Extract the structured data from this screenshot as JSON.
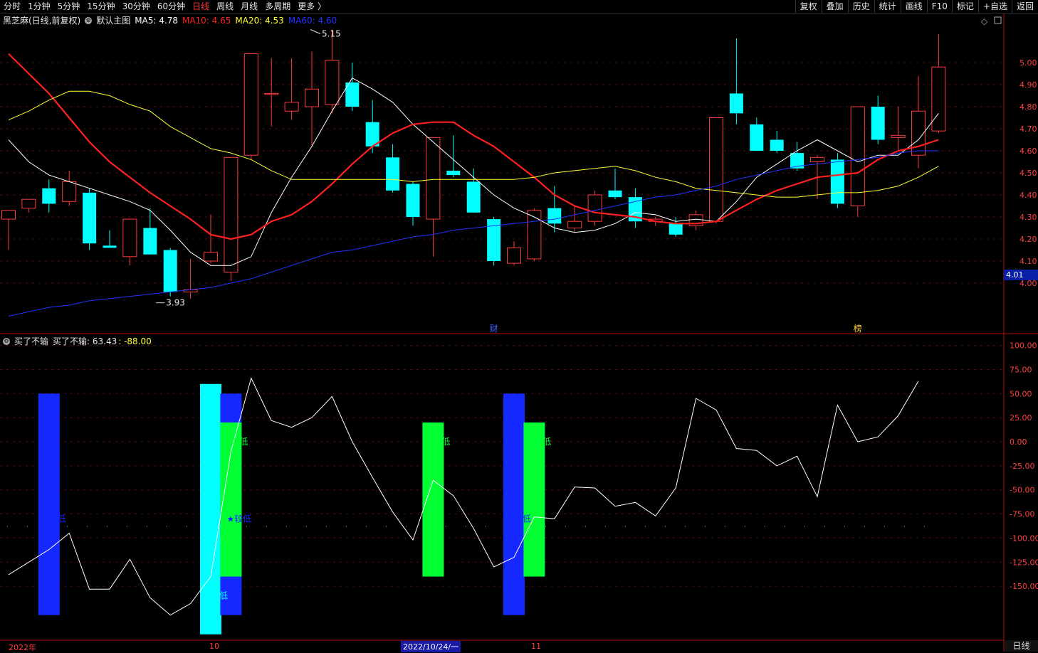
{
  "toolbar": {
    "left_items": [
      "分时",
      "1分钟",
      "5分钟",
      "15分钟",
      "30分钟",
      "60分钟",
      "日线",
      "周线",
      "月线",
      "多周期",
      "更多 〉"
    ],
    "active_item": "日线",
    "right_items": [
      "复权",
      "叠加",
      "历史",
      "统计",
      "画线",
      "F10",
      "标记",
      "+自选",
      "返回"
    ]
  },
  "main_legend": {
    "stock": "黑芝麻(日线,前复权)",
    "template": "默认主图",
    "ma5": "MA5: 4.78",
    "ma10": "MA10: 4.65",
    "ma20": "MA20: 4.53",
    "ma60": "MA60: 4.60"
  },
  "indicator_legend": {
    "name": "买了不输",
    "value_text": "买了不输: 63.43",
    "extra": ": -88.00"
  },
  "colors": {
    "up": "#ff3b3b",
    "down": "#00ffff",
    "ma5": "#ffffff",
    "ma10": "#ff2020",
    "ma20": "#ffff33",
    "ma60": "#2233ff",
    "axis": "#b01010"
  },
  "price_tag": "4.01",
  "bottom": {
    "label_2022": "2022年",
    "label_10": "10",
    "cursor_date": "2022/10/24/一",
    "label_11": "11",
    "period": "日线"
  },
  "chart_data": [
    {
      "type": "candlestick",
      "name": "price",
      "ylim": [
        3.8,
        5.25
      ],
      "yticks": [
        "5.00",
        "4.90",
        "4.80",
        "4.70",
        "4.60",
        "4.50",
        "4.40",
        "4.30",
        "4.20",
        "4.10",
        "4.00"
      ],
      "annotations": [
        {
          "text": "5.15",
          "index": 15,
          "value": 5.15,
          "type": "high"
        },
        {
          "text": "3.93",
          "index": 8,
          "value": 3.93,
          "type": "low"
        },
        {
          "text": "财",
          "index": 24
        },
        {
          "text": "榜",
          "index": 42
        }
      ],
      "ohlc": [
        [
          4.29,
          4.33,
          4.15,
          4.33
        ],
        [
          4.34,
          4.38,
          4.32,
          4.38
        ],
        [
          4.43,
          4.47,
          4.32,
          4.36
        ],
        [
          4.37,
          4.51,
          4.35,
          4.46
        ],
        [
          4.41,
          4.43,
          4.15,
          4.18
        ],
        [
          4.17,
          4.24,
          4.16,
          4.16
        ],
        [
          4.12,
          4.29,
          4.08,
          4.29
        ],
        [
          4.25,
          4.34,
          4.13,
          4.13
        ],
        [
          4.15,
          4.16,
          3.94,
          3.96
        ],
        [
          3.96,
          4.11,
          3.93,
          3.97
        ],
        [
          4.1,
          4.31,
          4.09,
          4.14
        ],
        [
          4.05,
          4.57,
          4.01,
          4.57
        ],
        [
          4.58,
          5.04,
          4.56,
          5.04
        ],
        [
          4.86,
          5.02,
          4.71,
          4.86
        ],
        [
          4.78,
          5.02,
          4.74,
          4.82
        ],
        [
          4.8,
          5.05,
          4.62,
          4.88
        ],
        [
          4.81,
          5.15,
          4.77,
          5.01
        ],
        [
          4.91,
          5.0,
          4.78,
          4.8
        ],
        [
          4.73,
          4.83,
          4.59,
          4.62
        ],
        [
          4.57,
          4.63,
          4.41,
          4.42
        ],
        [
          4.45,
          4.46,
          4.26,
          4.3
        ],
        [
          4.29,
          4.66,
          4.12,
          4.66
        ],
        [
          4.51,
          4.67,
          4.48,
          4.49
        ],
        [
          4.46,
          4.52,
          4.32,
          4.32
        ],
        [
          4.29,
          4.3,
          4.08,
          4.1
        ],
        [
          4.09,
          4.19,
          4.08,
          4.16
        ],
        [
          4.11,
          4.34,
          4.1,
          4.33
        ],
        [
          4.34,
          4.44,
          4.23,
          4.27
        ],
        [
          4.25,
          4.35,
          4.23,
          4.28
        ],
        [
          4.28,
          4.42,
          4.26,
          4.4
        ],
        [
          4.42,
          4.52,
          4.38,
          4.39
        ],
        [
          4.39,
          4.43,
          4.25,
          4.28
        ],
        [
          4.28,
          4.3,
          4.26,
          4.29
        ],
        [
          4.27,
          4.3,
          4.21,
          4.22
        ],
        [
          4.26,
          4.33,
          4.24,
          4.31
        ],
        [
          4.28,
          4.75,
          4.27,
          4.75
        ],
        [
          4.86,
          5.11,
          4.72,
          4.77
        ],
        [
          4.72,
          4.75,
          4.6,
          4.6
        ],
        [
          4.65,
          4.69,
          4.59,
          4.6
        ],
        [
          4.59,
          4.64,
          4.51,
          4.52
        ],
        [
          4.55,
          4.58,
          4.38,
          4.57
        ],
        [
          4.56,
          4.59,
          4.34,
          4.36
        ],
        [
          4.35,
          4.8,
          4.3,
          4.8
        ],
        [
          4.8,
          4.85,
          4.63,
          4.65
        ],
        [
          4.66,
          4.8,
          4.6,
          4.67
        ],
        [
          4.58,
          4.94,
          4.52,
          4.78
        ],
        [
          4.69,
          5.13,
          4.68,
          4.98
        ]
      ],
      "series": [
        {
          "name": "MA5",
          "values": [
            4.65,
            4.55,
            4.49,
            4.46,
            4.43,
            4.4,
            4.37,
            4.33,
            4.24,
            4.14,
            4.08,
            4.08,
            4.12,
            4.32,
            4.48,
            4.62,
            4.78,
            4.93,
            4.88,
            4.82,
            4.72,
            4.64,
            4.56,
            4.48,
            4.4,
            4.34,
            4.3,
            4.25,
            4.23,
            4.24,
            4.27,
            4.32,
            4.31,
            4.28,
            4.29,
            4.28,
            4.37,
            4.48,
            4.54,
            4.6,
            4.65,
            4.6,
            4.55,
            4.58,
            4.58,
            4.65,
            4.77
          ]
        },
        {
          "name": "MA10",
          "values": [
            5.04,
            4.95,
            4.86,
            4.75,
            4.64,
            4.55,
            4.48,
            4.41,
            4.35,
            4.29,
            4.22,
            4.2,
            4.22,
            4.28,
            4.31,
            4.37,
            4.45,
            4.54,
            4.62,
            4.68,
            4.72,
            4.73,
            4.73,
            4.67,
            4.62,
            4.55,
            4.48,
            4.4,
            4.35,
            4.32,
            4.31,
            4.3,
            4.28,
            4.27,
            4.27,
            4.28,
            4.33,
            4.38,
            4.42,
            4.45,
            4.48,
            4.49,
            4.5,
            4.56,
            4.6,
            4.62,
            4.65
          ]
        },
        {
          "name": "MA20",
          "values": [
            4.74,
            4.78,
            4.83,
            4.87,
            4.87,
            4.85,
            4.81,
            4.78,
            4.71,
            4.66,
            4.61,
            4.59,
            4.56,
            4.51,
            4.47,
            4.47,
            4.47,
            4.47,
            4.47,
            4.47,
            4.46,
            4.47,
            4.47,
            4.47,
            4.47,
            4.47,
            4.48,
            4.5,
            4.51,
            4.52,
            4.53,
            4.51,
            4.48,
            4.46,
            4.43,
            4.42,
            4.41,
            4.4,
            4.39,
            4.39,
            4.4,
            4.41,
            4.41,
            4.42,
            4.44,
            4.48,
            4.53
          ]
        },
        {
          "name": "MA60",
          "values": [
            3.85,
            3.87,
            3.89,
            3.9,
            3.92,
            3.93,
            3.94,
            3.95,
            3.96,
            3.97,
            3.98,
            4.0,
            4.02,
            4.05,
            4.08,
            4.11,
            4.14,
            4.15,
            4.17,
            4.19,
            4.21,
            4.22,
            4.24,
            4.25,
            4.26,
            4.27,
            4.28,
            4.29,
            4.31,
            4.33,
            4.35,
            4.37,
            4.39,
            4.4,
            4.42,
            4.44,
            4.47,
            4.49,
            4.51,
            4.53,
            4.54,
            4.55,
            4.56,
            4.57,
            4.59,
            4.6,
            4.6
          ]
        }
      ]
    },
    {
      "type": "line",
      "name": "买了不输",
      "ylim": [
        -170,
        110
      ],
      "yticks": [
        "100.00",
        "75.00",
        "50.00",
        "25.00",
        "0.00",
        "-25.00",
        "-50.00",
        "-75.00",
        "-100.00",
        "-125.00",
        "-150.00"
      ],
      "values": [
        -138,
        -125,
        -112,
        -95,
        -153,
        -153,
        -122,
        -162,
        -180,
        -168,
        -140,
        -10,
        66,
        22,
        15,
        25,
        47,
        0,
        -37,
        -73,
        -102,
        -40,
        -56,
        -90,
        -130,
        -120,
        -78,
        -80,
        -47,
        -48,
        -67,
        -63,
        -77,
        -48,
        45,
        33,
        -7,
        -9,
        -25,
        -15,
        -57,
        38,
        0,
        5,
        27,
        63
      ],
      "reference_line": -88,
      "bars": [
        {
          "index": 2,
          "top": 50,
          "bottom": -180,
          "color": "#1428ff"
        },
        {
          "index": 10,
          "top": 60,
          "bottom": -200,
          "color": "#00ffff"
        },
        {
          "index": 11,
          "top": 50,
          "bottom": -180,
          "color": "#1428ff"
        },
        {
          "index": 11,
          "top": 20,
          "bottom": -140,
          "color": "#00ff33"
        },
        {
          "index": 21,
          "top": 20,
          "bottom": -140,
          "color": "#00ff33"
        },
        {
          "index": 25,
          "top": 50,
          "bottom": -180,
          "color": "#1428ff"
        },
        {
          "index": 26,
          "top": 20,
          "bottom": -140,
          "color": "#00ff33"
        }
      ],
      "labels": [
        {
          "text": "较低",
          "index": 2,
          "value": -80,
          "color": "#1428ff"
        },
        {
          "text": "消低",
          "index": 11,
          "value": 0,
          "color": "#00ff33"
        },
        {
          "text": "★较低",
          "index": 11,
          "value": -80,
          "color": "#1428ff"
        },
        {
          "text": "极低",
          "index": 10,
          "value": -160,
          "color": "#00ffff"
        },
        {
          "text": "消低",
          "index": 21,
          "value": 0,
          "color": "#00ff33"
        },
        {
          "text": "消低",
          "index": 26,
          "value": 0,
          "color": "#00ff33"
        },
        {
          "text": "较低",
          "index": 25,
          "value": -80,
          "color": "#1428ff"
        }
      ]
    }
  ]
}
